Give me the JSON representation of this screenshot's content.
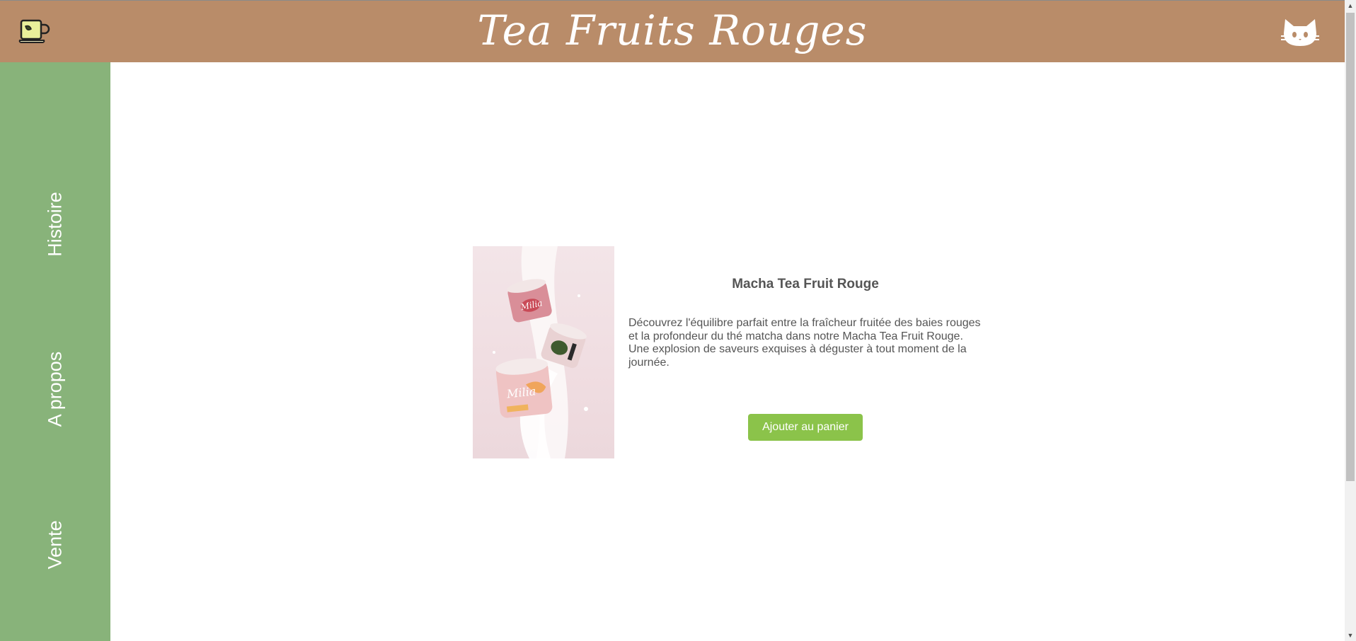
{
  "header": {
    "title": "Tea Fruits Rouges",
    "logo_icon": "teacup-icon",
    "account_icon": "cat-icon"
  },
  "sidebar": {
    "items": [
      {
        "label": "Histoire"
      },
      {
        "label": "A propos"
      },
      {
        "label": "Vente"
      }
    ]
  },
  "product": {
    "name": "Macha Tea Fruit Rouge",
    "description": "Découvrez l'équilibre parfait entre la fraîcheur fruitée des baies rouges et la profondeur du thé matcha dans notre Macha Tea Fruit Rouge. Une explosion de saveurs exquises à déguster à tout moment de la journée.",
    "image_label": "Milia",
    "add_to_cart_label": "Ajouter au panier"
  },
  "colors": {
    "header_bg": "#b98c69",
    "sidebar_bg": "#88b37a",
    "button_bg": "#8bc34a",
    "text": "#555555"
  }
}
